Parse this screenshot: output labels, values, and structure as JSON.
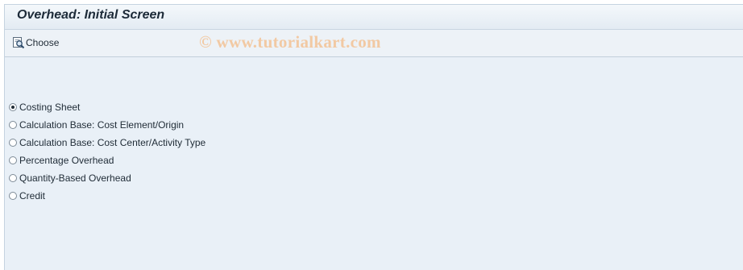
{
  "window": {
    "title": "Overhead: Initial Screen"
  },
  "toolbar": {
    "choose_label": "Choose",
    "choose_icon": "choose-icon"
  },
  "watermark": {
    "text": "© www.tutorialkart.com"
  },
  "options": [
    {
      "label": "Costing Sheet",
      "selected": true
    },
    {
      "label": "Calculation Base: Cost Element/Origin",
      "selected": false
    },
    {
      "label": "Calculation Base: Cost Center/Activity Type",
      "selected": false
    },
    {
      "label": "Percentage Overhead",
      "selected": false
    },
    {
      "label": "Quantity-Based Overhead",
      "selected": false
    },
    {
      "label": "Credit",
      "selected": false
    }
  ],
  "colors": {
    "background": "#e9f0f7",
    "title_text": "#1c2a38",
    "watermark": "#f2c9a3"
  }
}
